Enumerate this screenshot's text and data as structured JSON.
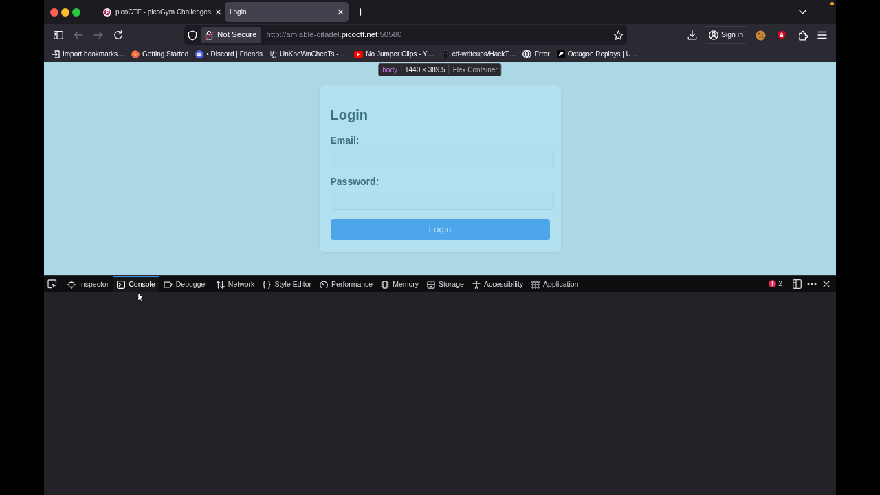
{
  "browser_tabs": [
    {
      "title": "picoCTF - picoGym Challenges",
      "selected": false,
      "favicon": true
    },
    {
      "title": "Login",
      "selected": true,
      "favicon": false
    }
  ],
  "nav": {
    "back": {
      "disabled": true
    },
    "forward": {
      "disabled": true
    }
  },
  "address_bar": {
    "security_label": "Not Secure",
    "url_parts": [
      {
        "text": "http://amiable-citadel.",
        "highlighted": false
      },
      {
        "text": "picoctf.net",
        "highlighted": true
      },
      {
        "text": ":50580",
        "highlighted": false
      }
    ]
  },
  "account_button": "Sign in",
  "bookmarks": [
    {
      "label": "Import bookmarks…",
      "kind": "import"
    },
    {
      "label": "Getting Started",
      "kind": "firefox"
    },
    {
      "label": "• Discord | Friends",
      "kind": "discord"
    },
    {
      "label": "UnKnoWnCheaTs - …",
      "kind": "monogram"
    },
    {
      "label": "No Jumper Clips - Y…",
      "kind": "youtube"
    },
    {
      "label": "ctf-writeups/HackT…",
      "kind": "github"
    },
    {
      "label": "Error",
      "kind": "globe"
    },
    {
      "label": "Octagon Replays | U…",
      "kind": "octagon"
    }
  ],
  "page": {
    "inspector_infobar": {
      "element": "body",
      "size": "1440 × 389.5",
      "layout": "Flex Container"
    },
    "login_card": {
      "title": "Login",
      "fields": [
        {
          "label": "Email:"
        },
        {
          "label": "Password:"
        }
      ],
      "submit": "Login"
    }
  },
  "devtools": {
    "tabs": [
      {
        "label": "Inspector",
        "kind": "inspector",
        "selected": false
      },
      {
        "label": "Console",
        "kind": "console",
        "selected": true
      },
      {
        "label": "Debugger",
        "kind": "debugger",
        "selected": false
      },
      {
        "label": "Network",
        "kind": "network",
        "selected": false
      },
      {
        "label": "Style Editor",
        "kind": "style-editor",
        "selected": false
      },
      {
        "label": "Performance",
        "kind": "performance",
        "selected": false
      },
      {
        "label": "Memory",
        "kind": "memory",
        "selected": false
      },
      {
        "label": "Storage",
        "kind": "storage",
        "selected": false
      },
      {
        "label": "Accessibility",
        "kind": "accessibility",
        "selected": false
      },
      {
        "label": "Application",
        "kind": "application",
        "selected": false
      }
    ],
    "error_count": "2"
  }
}
